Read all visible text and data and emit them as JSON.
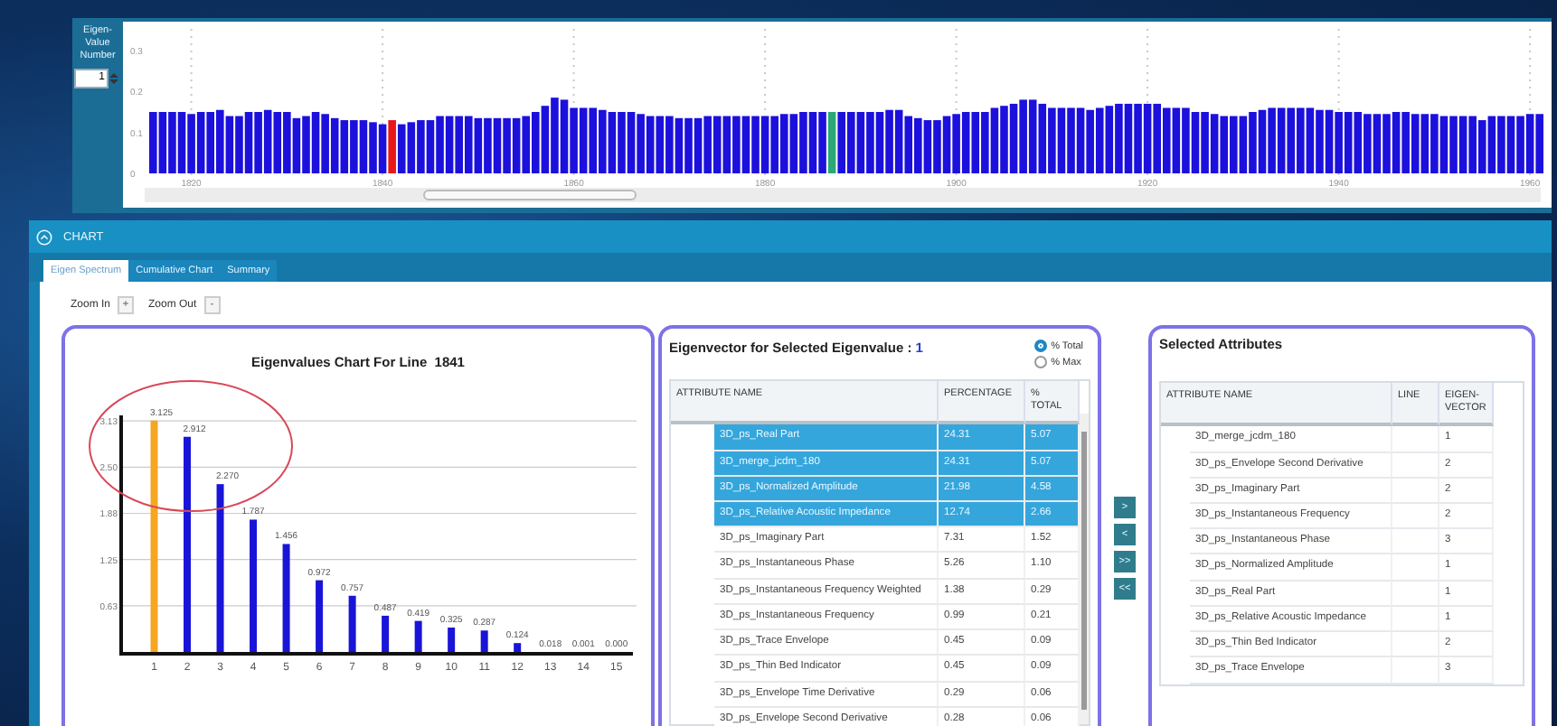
{
  "value_selector": {
    "label": "Eigen-Value Number",
    "value": "1"
  },
  "overview_chart": {
    "chart_data": {
      "type": "bar",
      "x": [
        1816,
        1817,
        1818,
        1819,
        1820,
        1821,
        1822,
        1823,
        1824,
        1825,
        1826,
        1827,
        1828,
        1829,
        1830,
        1831,
        1832,
        1833,
        1834,
        1835,
        1836,
        1837,
        1838,
        1839,
        1840,
        1841,
        1842,
        1843,
        1844,
        1845,
        1846,
        1847,
        1848,
        1849,
        1850,
        1851,
        1852,
        1853,
        1854,
        1855,
        1856,
        1857,
        1858,
        1859,
        1860,
        1861,
        1862,
        1863,
        1864,
        1865,
        1866,
        1867,
        1868,
        1869,
        1870,
        1871,
        1872,
        1873,
        1874,
        1875,
        1876,
        1877,
        1878,
        1879,
        1880,
        1881,
        1882,
        1883,
        1884,
        1885,
        1886,
        1887,
        1888,
        1889,
        1890,
        1891,
        1892,
        1893,
        1894,
        1895,
        1896,
        1897,
        1898,
        1899,
        1900,
        1901,
        1902,
        1903,
        1904,
        1905,
        1906,
        1907,
        1908,
        1909,
        1910,
        1911,
        1912,
        1913,
        1914,
        1915,
        1916,
        1917,
        1918,
        1919,
        1920,
        1921,
        1922,
        1923,
        1924,
        1925,
        1926,
        1927,
        1928,
        1929,
        1930,
        1931,
        1932,
        1933,
        1934,
        1935,
        1936,
        1937,
        1938,
        1939,
        1940,
        1941,
        1942,
        1943,
        1944,
        1945,
        1946,
        1947,
        1948,
        1949,
        1950,
        1951,
        1952,
        1953,
        1954,
        1955,
        1956,
        1957,
        1958,
        1959,
        1960,
        1961
      ],
      "series": [
        {
          "color": "#1c10dc",
          "values": [
            0.15,
            0.15,
            0.15,
            0.15,
            0.145,
            0.15,
            0.15,
            0.155,
            0.14,
            0.14,
            0.15,
            0.15,
            0.155,
            0.15,
            0.15,
            0.135,
            0.14,
            0.15,
            0.145,
            0.135,
            0.13,
            0.13,
            0.13,
            0.125,
            0.12,
            null,
            0.12,
            0.125,
            0.13,
            0.13,
            0.14,
            0.14,
            0.14,
            0.14,
            0.135,
            0.135,
            0.135,
            0.135,
            0.135,
            0.14,
            0.15,
            0.165,
            0.185,
            0.18,
            0.16,
            0.16,
            0.16,
            0.155,
            0.15,
            0.15,
            0.15,
            0.145,
            0.14,
            0.14,
            0.14,
            0.135,
            0.135,
            0.135,
            0.14,
            0.14,
            0.14,
            0.14,
            0.14,
            0.14,
            0.14,
            0.14,
            0.145,
            0.145,
            0.15,
            0.15,
            0.15,
            null,
            0.15,
            0.15,
            0.15,
            0.15,
            0.15,
            0.155,
            0.155,
            0.14,
            0.135,
            0.13,
            0.13,
            0.14,
            0.145,
            0.15,
            0.15,
            0.15,
            0.16,
            0.165,
            0.17,
            0.18,
            0.18,
            0.17,
            0.16,
            0.16,
            0.16,
            0.16,
            0.155,
            0.16,
            0.165,
            0.17,
            0.17,
            0.17,
            0.17,
            0.17,
            0.16,
            0.16,
            0.16,
            0.15,
            0.15,
            0.145,
            0.14,
            0.14,
            0.14,
            0.15,
            0.155,
            0.16,
            0.16,
            0.16,
            0.16,
            0.16,
            0.155,
            0.155,
            0.15,
            0.15,
            0.15,
            0.145,
            0.145,
            0.145,
            0.15,
            0.15,
            0.145,
            0.145,
            0.145,
            0.14,
            0.14,
            0.14,
            0.14,
            0.13,
            0.14,
            0.14,
            0.14,
            0.14,
            0.145,
            0.145
          ]
        },
        {
          "color": "#e81818",
          "values": [
            null,
            null,
            null,
            null,
            null,
            null,
            null,
            null,
            null,
            null,
            null,
            null,
            null,
            null,
            null,
            null,
            null,
            null,
            null,
            null,
            null,
            null,
            null,
            null,
            null,
            0.13,
            null,
            null,
            null,
            null,
            null,
            null,
            null,
            null,
            null,
            null,
            null,
            null,
            null,
            null,
            null,
            null,
            null,
            null,
            null,
            null,
            null,
            null,
            null,
            null,
            null,
            null,
            null,
            null,
            null,
            null,
            null,
            null,
            null,
            null,
            null,
            null,
            null,
            null,
            null,
            null,
            null,
            null,
            null,
            null,
            null,
            null,
            null,
            null,
            null,
            null,
            null,
            null,
            null,
            null,
            null,
            null,
            null,
            null,
            null,
            null,
            null,
            null,
            null,
            null,
            null,
            null,
            null,
            null,
            null,
            null,
            null,
            null,
            null,
            null,
            null,
            null,
            null,
            null,
            null,
            null,
            null,
            null,
            null,
            null,
            null,
            null,
            null,
            null,
            null,
            null,
            null,
            null,
            null,
            null,
            null,
            null,
            null,
            null,
            null,
            null,
            null,
            null,
            null,
            null,
            null,
            null,
            null,
            null,
            null,
            null,
            null,
            null,
            null,
            null,
            null,
            null,
            null,
            null,
            null,
            null
          ]
        },
        {
          "color": "#2aa878",
          "values": [
            null,
            null,
            null,
            null,
            null,
            null,
            null,
            null,
            null,
            null,
            null,
            null,
            null,
            null,
            null,
            null,
            null,
            null,
            null,
            null,
            null,
            null,
            null,
            null,
            null,
            null,
            null,
            null,
            null,
            null,
            null,
            null,
            null,
            null,
            null,
            null,
            null,
            null,
            null,
            null,
            null,
            null,
            null,
            null,
            null,
            null,
            null,
            null,
            null,
            null,
            null,
            null,
            null,
            null,
            null,
            null,
            null,
            null,
            null,
            null,
            null,
            null,
            null,
            null,
            null,
            null,
            null,
            null,
            null,
            null,
            null,
            0.15,
            null,
            null,
            null,
            null,
            null,
            null,
            null,
            null,
            null,
            null,
            null,
            null,
            null,
            null,
            null,
            null,
            null,
            null,
            null,
            null,
            null,
            null,
            null,
            null,
            null,
            null,
            null,
            null,
            null,
            null,
            null,
            null,
            null,
            null,
            null,
            null,
            null,
            null,
            null,
            null,
            null,
            null,
            null,
            null,
            null,
            null,
            null,
            null,
            null,
            null,
            null,
            null,
            null,
            null,
            null,
            null,
            null,
            null,
            null,
            null,
            null,
            null,
            null,
            null,
            null,
            null,
            null,
            null,
            null,
            null,
            null,
            null,
            null,
            null
          ]
        }
      ],
      "xlim": [
        1815.5,
        1961.5
      ],
      "xticks": [
        1820,
        1840,
        1860,
        1880,
        1900,
        1920,
        1940,
        1960
      ],
      "yticks": [
        0,
        0.1,
        0.2,
        0.3
      ],
      "ylim": [
        0,
        0.3
      ],
      "grid": true
    }
  },
  "section": {
    "title": "CHART",
    "expanded": true
  },
  "tabs": [
    {
      "label": "Eigen Spectrum",
      "selected": true
    },
    {
      "label": "Cumulative Chart",
      "selected": false
    },
    {
      "label": "Summary",
      "selected": false
    }
  ],
  "zoom": [
    {
      "label": "Zoom In",
      "button": "+"
    },
    {
      "label": "Zoom Out",
      "button": "-"
    }
  ],
  "eigenvalues_panel": {
    "title": "Eigenvalues Chart For Line  1841",
    "circled_marker": {
      "color": "#d84858"
    },
    "chart_data": {
      "type": "bar",
      "x": [
        1,
        2,
        3,
        4,
        5,
        6,
        7,
        8,
        9,
        10,
        11,
        12,
        13,
        14,
        15
      ],
      "xticks": [
        1,
        2,
        3,
        4,
        5,
        6,
        7,
        8,
        9,
        10,
        11,
        12,
        13,
        14,
        15
      ],
      "xlim": [
        0,
        15.5
      ],
      "series": [
        {
          "color": "#f5a623",
          "values": [
            3.13,
            null,
            null,
            null,
            null,
            null,
            null,
            null,
            null,
            null,
            null,
            null,
            null,
            null,
            null
          ]
        },
        {
          "color": "#1a14d8",
          "values": [
            null,
            2.91,
            2.27,
            1.79,
            1.46,
            0.97,
            0.76,
            0.49,
            0.42,
            0.33,
            0.29,
            0.12,
            0,
            0,
            0
          ]
        }
      ],
      "value_labels": [
        "3.125",
        "2.912",
        "2.270",
        "1.787",
        "1.456",
        "0.972",
        "0.757",
        "0.487",
        "0.419",
        "0.325",
        "0.287",
        "0.124",
        "0.018",
        "0.001",
        "0.000"
      ],
      "yticks": [
        {
          "value": 0.625,
          "label": "0.63"
        },
        {
          "value": 1.25,
          "label": "1.25"
        },
        {
          "value": 1.875,
          "label": "1.88"
        },
        {
          "value": 2.5,
          "label": "2.50"
        },
        {
          "value": 3.125,
          "label": "3.13"
        }
      ],
      "ylim": [
        0,
        3.2
      ],
      "grid": true
    }
  },
  "eigenvector_panel": {
    "title": "Eigenvector for Selected Eigenvalue : ",
    "eigenvalue": "1",
    "modes": [
      {
        "label": "% Total",
        "selected": true
      },
      {
        "label": "% Max",
        "selected": false
      }
    ],
    "columns": [
      "ATTRIBUTE NAME",
      "PERCENTAGE",
      "% TOTAL"
    ],
    "rows": [
      {
        "name": "3D_ps_Real Part",
        "percentage": "24.31",
        "total": "5.07",
        "selected": true
      },
      {
        "name": "3D_merge_jcdm_180",
        "percentage": "24.31",
        "total": "5.07",
        "selected": true
      },
      {
        "name": "3D_ps_Normalized Amplitude",
        "percentage": "21.98",
        "total": "4.58",
        "selected": true
      },
      {
        "name": "3D_ps_Relative Acoustic Impedance",
        "percentage": "12.74",
        "total": "2.66",
        "selected": true
      },
      {
        "name": "3D_ps_Imaginary Part",
        "percentage": "7.31",
        "total": "1.52",
        "selected": false
      },
      {
        "name": "3D_ps_Instantaneous Phase",
        "percentage": "5.26",
        "total": "1.10",
        "selected": false
      },
      {
        "name": "3D_ps_Instantaneous Frequency Weighted",
        "percentage": "1.38",
        "total": "0.29",
        "selected": false
      },
      {
        "name": "3D_ps_Instantaneous Frequency",
        "percentage": "0.99",
        "total": "0.21",
        "selected": false
      },
      {
        "name": "3D_ps_Trace Envelope",
        "percentage": "0.45",
        "total": "0.09",
        "selected": false
      },
      {
        "name": "3D_ps_Thin Bed Indicator",
        "percentage": "0.45",
        "total": "0.09",
        "selected": false
      },
      {
        "name": "3D_ps_Envelope Time Derivative",
        "percentage": "0.29",
        "total": "0.06",
        "selected": false
      },
      {
        "name": "3D_ps_Envelope Second Derivative",
        "percentage": "0.28",
        "total": "0.06",
        "selected": false
      }
    ]
  },
  "transfer_buttons": [
    ">",
    "<",
    ">>",
    "<<"
  ],
  "selected_panel": {
    "title": "Selected Attributes",
    "columns": [
      "ATTRIBUTE NAME",
      "LINE",
      "EIGEN-VECTOR"
    ],
    "rows": [
      {
        "name": "3D_merge_jcdm_180",
        "eigenvector": "1"
      },
      {
        "name": "3D_ps_Envelope Second Derivative",
        "eigenvector": "2"
      },
      {
        "name": "3D_ps_Imaginary Part",
        "eigenvector": "2"
      },
      {
        "name": "3D_ps_Instantaneous Frequency",
        "eigenvector": "2"
      },
      {
        "name": "3D_ps_Instantaneous Phase",
        "eigenvector": "3"
      },
      {
        "name": "3D_ps_Normalized Amplitude",
        "eigenvector": "1"
      },
      {
        "name": "3D_ps_Real Part",
        "eigenvector": "1"
      },
      {
        "name": "3D_ps_Relative Acoustic Impedance",
        "eigenvector": "1"
      },
      {
        "name": "3D_ps_Thin Bed Indicator",
        "eigenvector": "2"
      },
      {
        "name": "3D_ps_Trace Envelope",
        "eigenvector": "3"
      }
    ]
  }
}
